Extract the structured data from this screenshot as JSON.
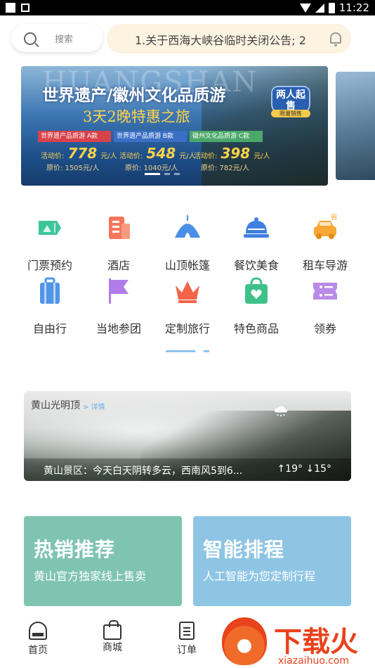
{
  "status_bar": {
    "time": "11:22"
  },
  "search": {
    "label": "搜索"
  },
  "notice": {
    "text": "1.关于西海大峡谷临时关闭公告; 2"
  },
  "banner": {
    "watermark": "HUANGSHAN",
    "title": "世界遗产/徽州文化品质游",
    "subtitle": "3天2晚特惠之旅",
    "badge": "两人起售",
    "badge_note": "限量销售",
    "packages": [
      {
        "name": "世界遗产品质游 A款",
        "price_label": "活动价:",
        "price": "778",
        "unit": "元/人",
        "original": "原价: 1505元/人"
      },
      {
        "name": "世界遗产品质游 B款",
        "price_label": "活动价:",
        "price": "548",
        "unit": "元/人",
        "original": "原价: 1040元/人"
      },
      {
        "name": "徽州文化品质游 C款",
        "price_label": "活动价:",
        "price": "398",
        "unit": "元/人",
        "original": "原价: 782元/人"
      }
    ]
  },
  "categories": [
    {
      "label": "门票预约",
      "icon": "ticket-icon",
      "color": "#3dc69b"
    },
    {
      "label": "酒店",
      "icon": "hotel-icon",
      "color": "#f5765a"
    },
    {
      "label": "山顶帐篷",
      "icon": "tent-icon",
      "color": "#4a8fe8"
    },
    {
      "label": "餐饮美食",
      "icon": "cloche-icon",
      "color": "#3f7fe0"
    },
    {
      "label": "租车导游",
      "icon": "car-icon",
      "color": "#f7a733",
      "tag": "租"
    },
    {
      "label": "自由行",
      "icon": "suitcase-icon",
      "color": "#4f95e8"
    },
    {
      "label": "当地参团",
      "icon": "flag-icon",
      "color": "#b07de8"
    },
    {
      "label": "定制旅行",
      "icon": "crown-icon",
      "color": "#f2634a"
    },
    {
      "label": "特色商品",
      "icon": "shopping-bag-icon",
      "color": "#3fc28a"
    },
    {
      "label": "领券",
      "icon": "coupon-icon",
      "color": "#b98be8"
    }
  ],
  "weather": {
    "location": "黄山光明顶",
    "detail_link": "> 详情",
    "forecast": "黄山景区：今天白天阴转多云，西南风5到6...",
    "temperature": "↑19° ↓15°",
    "icon": "snow-cloud-icon"
  },
  "promos": [
    {
      "title": "热销推荐",
      "subtitle": "黄山官方独家线上售卖",
      "color": "#7fc4b1"
    },
    {
      "title": "智能排程",
      "subtitle": "人工智能为您定制行程",
      "color": "#8ec5e4"
    }
  ],
  "tabs": [
    {
      "label": "首页",
      "icon": "home-icon"
    },
    {
      "label": "商城",
      "icon": "bag-icon"
    },
    {
      "label": "订单",
      "icon": "order-icon"
    }
  ],
  "watermark": {
    "text": "下载火",
    "url": "xiazaihuo.com"
  }
}
